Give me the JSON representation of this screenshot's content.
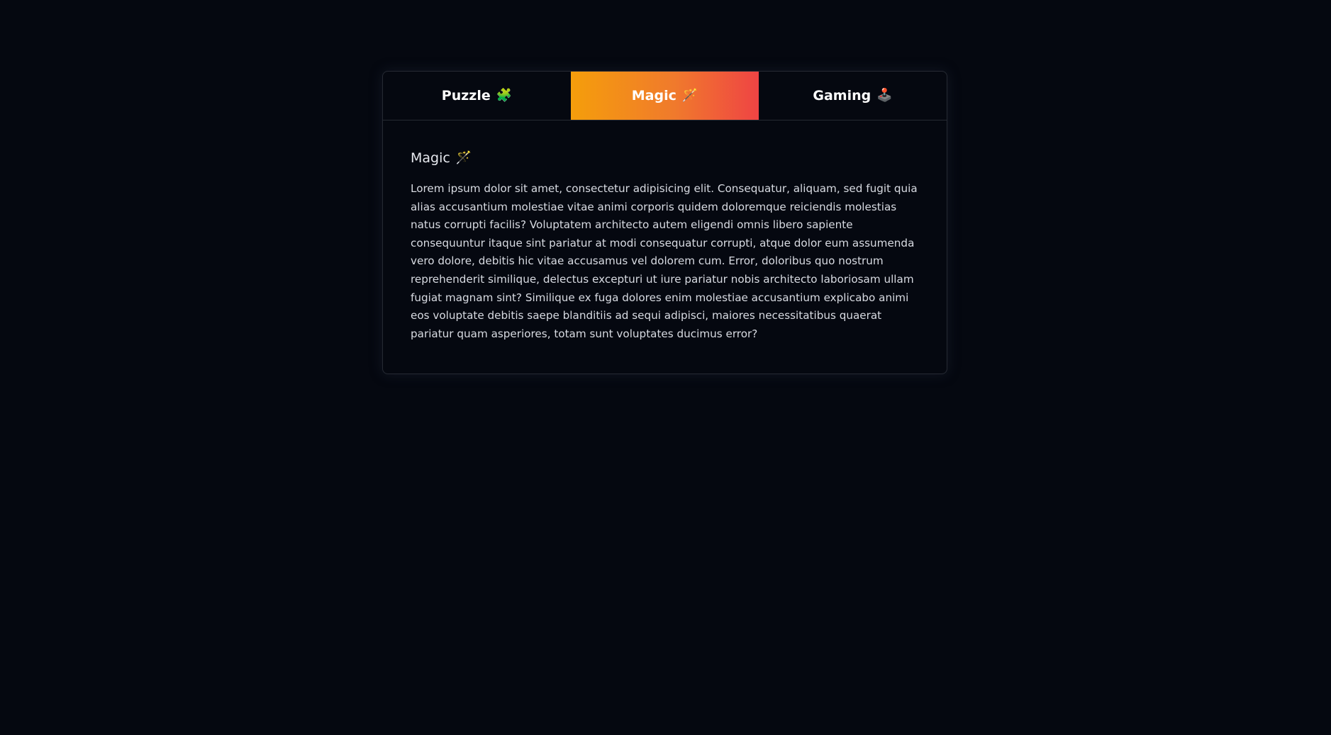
{
  "tabs": [
    {
      "label": "Puzzle",
      "icon": "🧩",
      "icon_name": "puzzle-piece-icon",
      "active": false
    },
    {
      "label": "Magic",
      "icon": "🪄",
      "icon_name": "magic-wand-icon",
      "active": true
    },
    {
      "label": "Gaming",
      "icon": "🕹️",
      "icon_name": "joystick-icon",
      "active": false
    }
  ],
  "panel": {
    "title": "Magic",
    "title_icon": "🪄",
    "text": "Lorem ipsum dolor sit amet, consectetur adipisicing elit. Consequatur, aliquam, sed fugit quia alias accusantium molestiae vitae animi corporis quidem doloremque reiciendis molestias natus corrupti facilis? Voluptatem architecto autem eligendi omnis libero sapiente consequuntur itaque sint pariatur at modi consequatur corrupti, atque dolor eum assumenda vero dolore, debitis hic vitae accusamus vel dolorem cum. Error, doloribus quo nostrum reprehenderit similique, delectus excepturi ut iure pariatur nobis architecto laboriosam ullam fugiat magnam sint? Similique ex fuga dolores enim molestiae accusantium explicabo animi eos voluptate debitis saepe blanditiis ad sequi adipisci, maiores necessitatibus quaerat pariatur quam asperiores, totam sunt voluptates ducimus error?"
  },
  "colors": {
    "background": "#050810",
    "active_gradient_start": "#f59e0b",
    "active_gradient_end": "#ef4444",
    "border": "#262a33"
  }
}
